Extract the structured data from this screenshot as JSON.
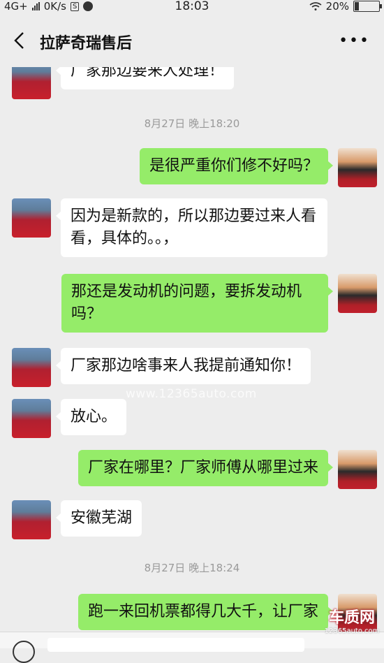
{
  "status_bar": {
    "network": "4G+",
    "speed": "0K/s",
    "badge": "S",
    "time": "18:03",
    "battery": "20%",
    "battery_level": 0.2
  },
  "nav": {
    "title": "拉萨奇瑞售后",
    "more": "•••"
  },
  "messages": [
    {
      "side": "in",
      "text": "厂家那边要来人处理！"
    },
    {
      "type": "time",
      "text": "8月27日 晚上18:20"
    },
    {
      "side": "out",
      "text": "是很严重你们修不好吗？"
    },
    {
      "side": "in",
      "text": "因为是新款的，所以那边要过来人看看，具体的。。，"
    },
    {
      "side": "out",
      "text": "那还是发动机的问题，要拆发动机吗？"
    },
    {
      "side": "in",
      "text": "厂家那边啥事来人我提前通知你！"
    },
    {
      "side": "in",
      "text": "放心。"
    },
    {
      "side": "out",
      "text": "厂家在哪里？厂家师傅从哪里过来"
    },
    {
      "side": "in",
      "text": "安徽芜湖"
    },
    {
      "type": "time",
      "text": "8月27日 晚上18:24"
    },
    {
      "side": "out",
      "text": "跑一来回机票都得几大千，让厂家"
    }
  ],
  "watermark": "www.12365auto.com",
  "logo": {
    "big": "车质网",
    "small": "12365auto.com"
  }
}
